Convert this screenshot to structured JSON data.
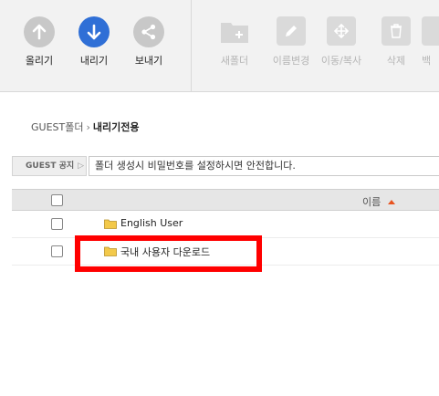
{
  "toolbar": {
    "upload_label": "올리기",
    "download_label": "내리기",
    "send_label": "보내기",
    "new_folder_label": "새폴더",
    "rename_label": "이름변경",
    "move_copy_label": "이동/복사",
    "delete_label": "삭제",
    "backup_label": "백"
  },
  "breadcrumb": {
    "root": "GUEST폴더",
    "separator": "›",
    "current": "내리기전용"
  },
  "notice": {
    "tag": "GUEST 공지",
    "tag_arrow": "▷",
    "message": "폴더 생성시 비밀번호를 설정하시면 안전합니다."
  },
  "table": {
    "name_header": "이름",
    "rows": [
      {
        "name": "English User"
      },
      {
        "name": "국내 사용자 다운로드"
      }
    ]
  },
  "colors": {
    "accent_blue": "#2f6fd6",
    "highlight_red": "#ff0000",
    "sort_arrow": "#e8531f",
    "folder_yellow": "#f3c94a"
  }
}
